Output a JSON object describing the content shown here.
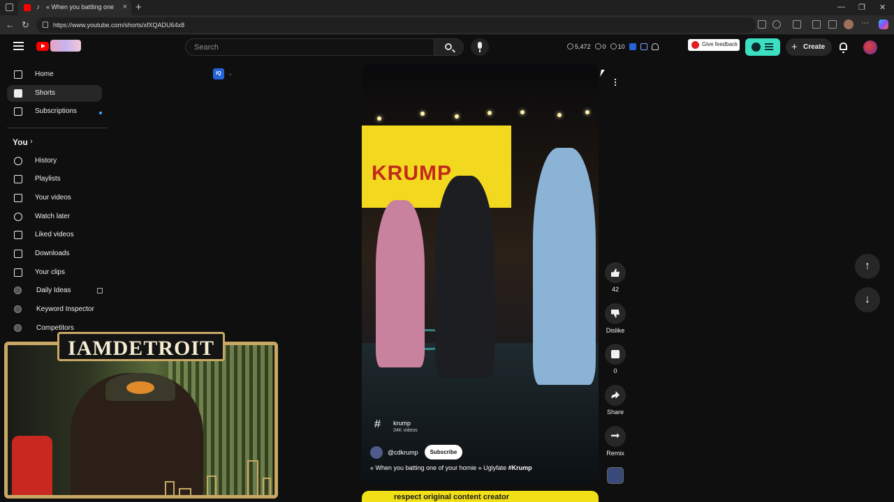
{
  "browser": {
    "tab_title": "« When you battling one of",
    "new_tab_label": "+",
    "url": "https://www.youtube.com/shorts/xfXQADU64x8"
  },
  "header": {
    "search_placeholder": "Search",
    "stats": {
      "views": "5,472",
      "comments": "0",
      "count": "10"
    },
    "feedback_label": "Give feedback",
    "create_label": "Create"
  },
  "sidebar": {
    "main": [
      {
        "label": "Home",
        "icon": "home-icon"
      },
      {
        "label": "Shorts",
        "icon": "shorts-icon",
        "active": true
      },
      {
        "label": "Subscriptions",
        "icon": "subscriptions-icon"
      }
    ],
    "you_header": "You",
    "you_items": [
      {
        "label": "History",
        "icon": "history-icon"
      },
      {
        "label": "Playlists",
        "icon": "playlists-icon"
      },
      {
        "label": "Your videos",
        "icon": "your-videos-icon"
      },
      {
        "label": "Watch later",
        "icon": "watch-later-icon"
      },
      {
        "label": "Liked videos",
        "icon": "liked-videos-icon"
      },
      {
        "label": "Downloads",
        "icon": "downloads-icon"
      },
      {
        "label": "Your clips",
        "icon": "clips-icon"
      },
      {
        "label": "Daily Ideas",
        "icon": "vidiq-icon"
      },
      {
        "label": "Keyword Inspector",
        "icon": "vidiq-icon"
      },
      {
        "label": "Competitors",
        "icon": "vidiq-icon"
      }
    ]
  },
  "vidiq": {
    "badge": "IQ"
  },
  "short": {
    "stage_banner_text": "KRUMP",
    "hashtag": "krump",
    "hashtag_count": "34K videos",
    "channel_handle": "@cdkrump",
    "subscribe_label": "Subscribe",
    "title_prefix": "« When you batting one of your homie » Uglyfate ",
    "title_tag": "#Krump",
    "next_short_caption": "respect original content creator"
  },
  "actions": {
    "like_count": "42",
    "dislike_label": "Dislike",
    "comment_count": "0",
    "share_label": "Share",
    "remix_label": "Remix"
  },
  "webcam": {
    "overlay_title": "IAMDETROIT"
  },
  "colors": {
    "accent_vidiq": "#3be0c2",
    "youtube_red": "#ff0000",
    "frame_gold": "#c9a865"
  }
}
